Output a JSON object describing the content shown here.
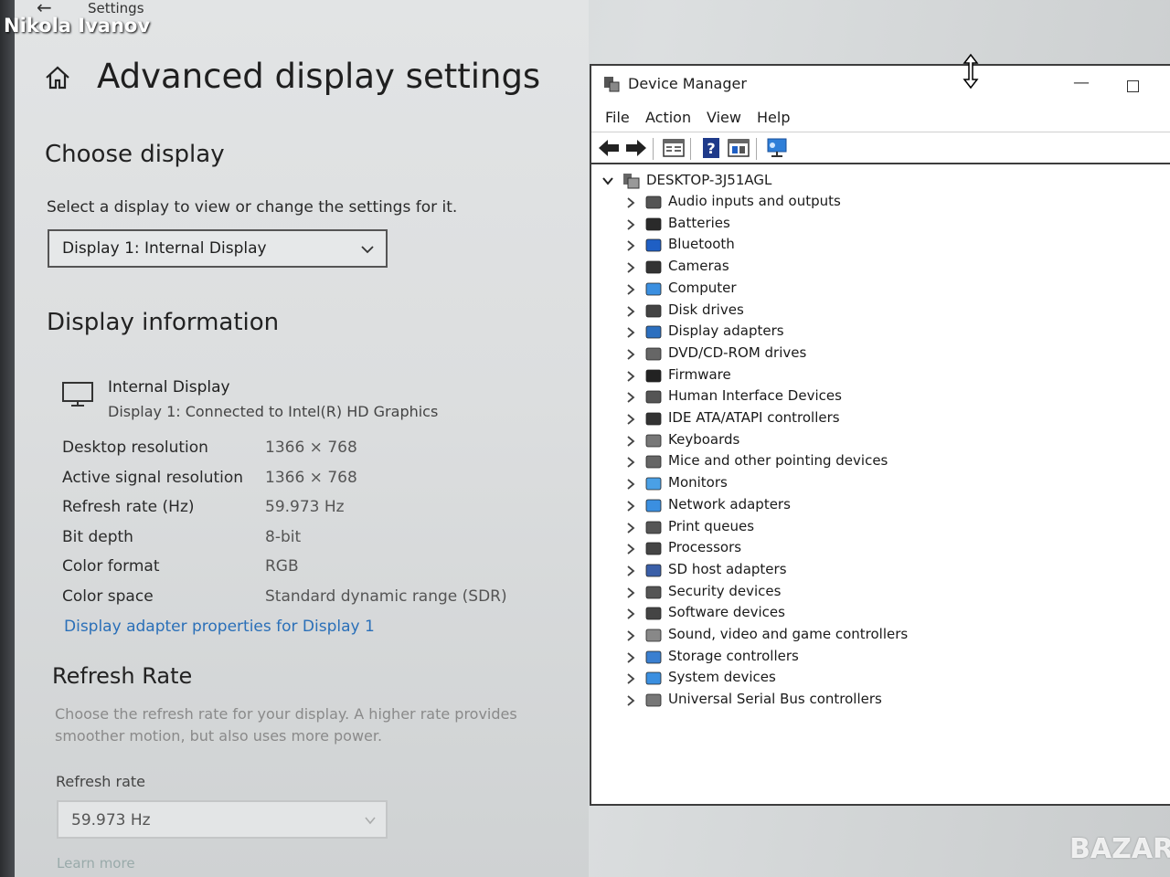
{
  "overlay": {
    "user_name": "Nikola Ivanov",
    "site_watermark": "BAZAR"
  },
  "settings": {
    "window_title": "Settings",
    "page_title": "Advanced display settings",
    "choose_display": {
      "heading": "Choose display",
      "instruction": "Select a display to view or change the settings for it.",
      "selected": "Display 1: Internal Display"
    },
    "display_information": {
      "heading": "Display information",
      "display_name": "Internal Display",
      "display_sub": "Display 1: Connected to Intel(R) HD Graphics",
      "rows": [
        {
          "label": "Desktop resolution",
          "value": "1366 × 768"
        },
        {
          "label": "Active signal resolution",
          "value": "1366 × 768"
        },
        {
          "label": "Refresh rate (Hz)",
          "value": "59.973 Hz"
        },
        {
          "label": "Bit depth",
          "value": "8-bit"
        },
        {
          "label": "Color format",
          "value": "RGB"
        },
        {
          "label": "Color space",
          "value": "Standard dynamic range (SDR)"
        }
      ],
      "adapter_link": "Display adapter properties for Display 1"
    },
    "refresh_rate": {
      "heading": "Refresh Rate",
      "description_line1": "Choose the refresh rate for your display. A higher rate provides",
      "description_line2": "smoother motion, but also uses more power.",
      "label": "Refresh rate",
      "selected": "59.973 Hz",
      "learn_more": "Learn more"
    }
  },
  "device_manager": {
    "title": "Device Manager",
    "menu": [
      "File",
      "Action",
      "View",
      "Help"
    ],
    "toolbar_icons": [
      "back-arrow-icon",
      "forward-arrow-icon",
      "properties-icon",
      "help-icon",
      "update-driver-icon",
      "scan-hardware-icon"
    ],
    "root": "DESKTOP-3J51AGL",
    "categories": [
      {
        "label": "Audio inputs and outputs",
        "icon": "speaker-icon"
      },
      {
        "label": "Batteries",
        "icon": "battery-icon"
      },
      {
        "label": "Bluetooth",
        "icon": "bluetooth-icon"
      },
      {
        "label": "Cameras",
        "icon": "camera-icon"
      },
      {
        "label": "Computer",
        "icon": "computer-icon"
      },
      {
        "label": "Disk drives",
        "icon": "disk-drive-icon"
      },
      {
        "label": "Display adapters",
        "icon": "display-adapter-icon"
      },
      {
        "label": "DVD/CD-ROM drives",
        "icon": "dvd-icon"
      },
      {
        "label": "Firmware",
        "icon": "firmware-icon"
      },
      {
        "label": "Human Interface Devices",
        "icon": "hid-icon"
      },
      {
        "label": "IDE ATA/ATAPI controllers",
        "icon": "ide-controller-icon"
      },
      {
        "label": "Keyboards",
        "icon": "keyboard-icon"
      },
      {
        "label": "Mice and other pointing devices",
        "icon": "mouse-icon"
      },
      {
        "label": "Monitors",
        "icon": "monitor-icon"
      },
      {
        "label": "Network adapters",
        "icon": "network-adapter-icon"
      },
      {
        "label": "Print queues",
        "icon": "printer-icon"
      },
      {
        "label": "Processors",
        "icon": "processor-icon"
      },
      {
        "label": "SD host adapters",
        "icon": "sd-card-icon"
      },
      {
        "label": "Security devices",
        "icon": "security-device-icon"
      },
      {
        "label": "Software devices",
        "icon": "software-device-icon"
      },
      {
        "label": "Sound, video and game controllers",
        "icon": "sound-icon"
      },
      {
        "label": "Storage controllers",
        "icon": "storage-controller-icon"
      },
      {
        "label": "System devices",
        "icon": "system-device-icon"
      },
      {
        "label": "Universal Serial Bus controllers",
        "icon": "usb-icon"
      }
    ]
  }
}
